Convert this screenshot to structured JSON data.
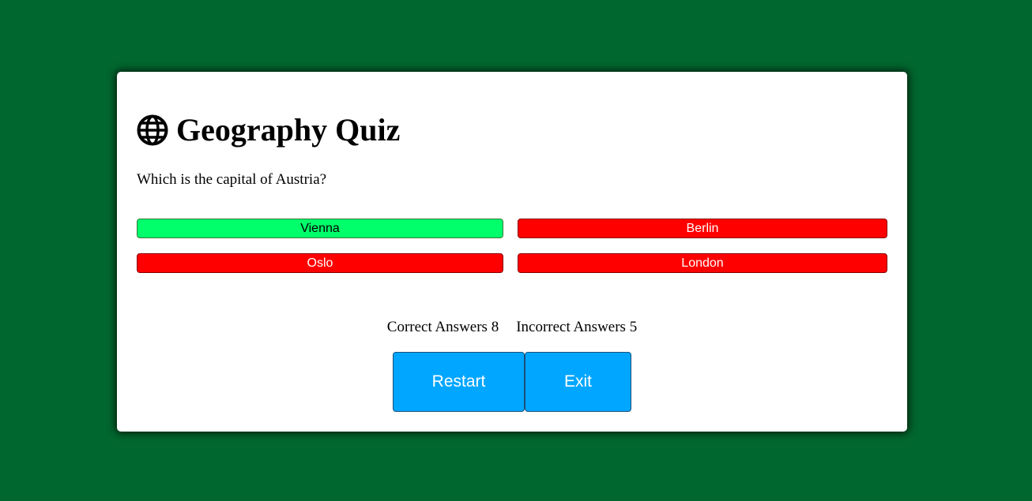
{
  "colors": {
    "page_background": "#00672e",
    "card_background": "#ffffff",
    "correct": "#00ff6a",
    "incorrect": "#ff0000",
    "action_button": "#00a6ff"
  },
  "quiz": {
    "icon": "globe-icon",
    "title": "Geography Quiz",
    "question": "Which is the capital of Austria?",
    "answers": [
      {
        "label": "Vienna",
        "state": "correct"
      },
      {
        "label": "Berlin",
        "state": "incorrect"
      },
      {
        "label": "Oslo",
        "state": "incorrect"
      },
      {
        "label": "London",
        "state": "incorrect"
      }
    ],
    "score": {
      "correct_label": "Correct Answers",
      "correct_count": "8",
      "incorrect_label": "Incorrect Answers",
      "incorrect_count": "5"
    },
    "buttons": {
      "restart": "Restart",
      "exit": "Exit"
    }
  }
}
